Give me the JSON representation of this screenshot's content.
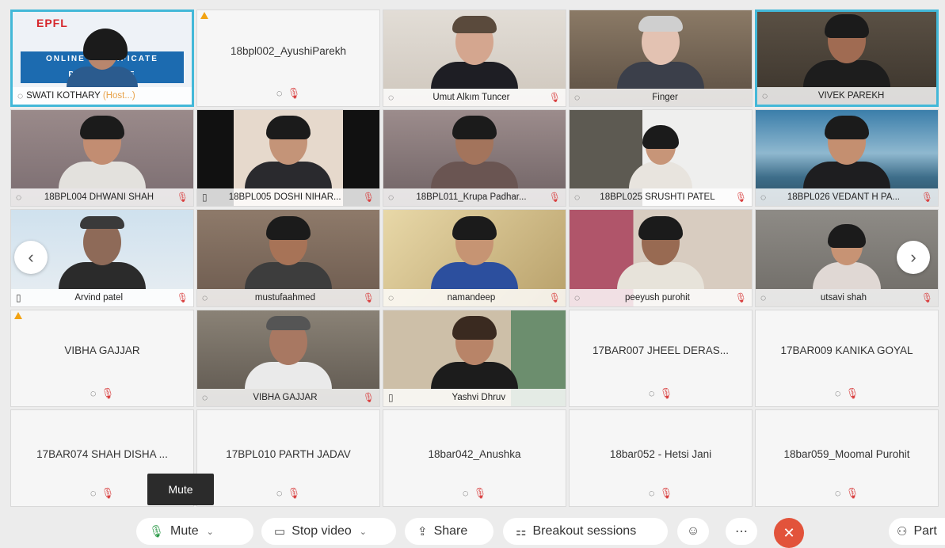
{
  "tiles": [
    {
      "name": "SWATI KOTHARY",
      "suffix": "(Host...)",
      "type": "slide",
      "slide_logo": "EPFL",
      "slide_band": "ONLINE CERTIFICATE PROGRAMME"
    },
    {
      "name": "18bpl002_AyushiParekh",
      "type": "nocam"
    },
    {
      "name": "Umut Alkım Tuncer",
      "type": "video"
    },
    {
      "name": "Finger",
      "type": "video"
    },
    {
      "name": "VIVEK PAREKH",
      "type": "video"
    },
    {
      "name": "18BPL004 DHWANI SHAH",
      "type": "video"
    },
    {
      "name": "18BPL005 DOSHI NIHAR...",
      "type": "video"
    },
    {
      "name": "18BPL011_Krupa Padhar...",
      "type": "video"
    },
    {
      "name": "18BPL025 SRUSHTI PATEL",
      "type": "video"
    },
    {
      "name": "18BPL026 VEDANT H PA...",
      "type": "video"
    },
    {
      "name": "Arvind patel",
      "type": "video"
    },
    {
      "name": "mustufaahmed",
      "type": "video"
    },
    {
      "name": "namandeep",
      "type": "video"
    },
    {
      "name": "peeyush purohit",
      "type": "video"
    },
    {
      "name": "utsavi shah",
      "type": "video"
    },
    {
      "name": "VIBHA GAJJAR",
      "type": "nocam"
    },
    {
      "name": "VIBHA GAJJAR",
      "type": "video"
    },
    {
      "name": "Yashvi Dhruv",
      "type": "video"
    },
    {
      "name": "17BAR007 JHEEL DERAS...",
      "type": "nocam"
    },
    {
      "name": "17BAR009 KANIKA GOYAL",
      "type": "nocam"
    },
    {
      "name": "17BAR074 SHAH DISHA ...",
      "type": "nocam"
    },
    {
      "name": "17BPL010 PARTH JADAV",
      "type": "nocam"
    },
    {
      "name": "18bar042_Anushka",
      "type": "nocam"
    },
    {
      "name": "18bar052 - Hetsi Jani",
      "type": "nocam"
    },
    {
      "name": "18bar059_Moomal Purohit",
      "type": "nocam"
    }
  ],
  "tooltip": "Mute",
  "toolbar": {
    "mute": "Mute",
    "stop_video": "Stop video",
    "share": "Share",
    "breakout": "Breakout sessions",
    "participants": "Part"
  },
  "colors": {
    "accent": "#43b8d8",
    "end": "#e2533b",
    "muted": "#d94040"
  }
}
